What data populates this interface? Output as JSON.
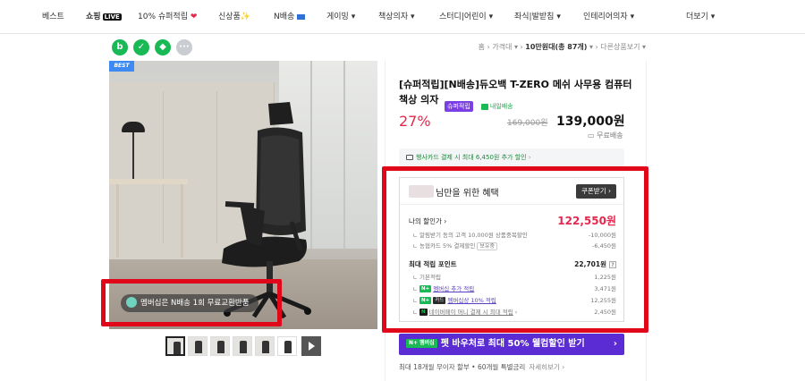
{
  "nav": {
    "items": [
      "베스트",
      "쇼핑",
      "10% 슈퍼적립",
      "신상품",
      "N배송",
      "게이밍",
      "책상의자",
      "스터디|어린이",
      "좌식|발받침",
      "인테리어의자",
      "더보기"
    ],
    "live_badge": "LIVE",
    "super_emoji": "❤",
    "new_emoji": "✨"
  },
  "breadcrumb": [
    "홈",
    "가격대",
    "10만원대(총 87개)",
    "다른상품보기"
  ],
  "image": {
    "best_badge": "BEST",
    "membership_pill": "멤버십은 N배송 1회 무료교환반품"
  },
  "product": {
    "title": "[슈퍼적립][N배송]듀오백 T-ZERO 메쉬 사무용 컴퓨터 책상 의자",
    "badge_super": "슈퍼적립",
    "badge_next": "내일배송",
    "discount": "27%",
    "old_price": "169,000원",
    "price": "139,000원",
    "delivery": "무료배송"
  },
  "card_promo": "행사카드 결제 시 최대 6,450원 추가 할인",
  "benefit": {
    "title": "님만을 위한 혜택",
    "coupon_btn": "쿠폰받기",
    "my_price_label": "나의 할인가",
    "my_price": "122,550원",
    "sub1_label": "알림받기 동의 고객 10,000원 상품중복할인",
    "sub1_val": "-10,000원",
    "sub2_label": "농협카드 5% 결제할인",
    "sub2_pill": "보유중",
    "sub2_val": "-6,450원",
    "points_label": "최대 적립 포인트",
    "points_val": "22,701원",
    "p1_label": "기본적립",
    "p1_val": "1,225원",
    "p2_label": "멤버십 추가 적립",
    "p2_val": "3,471원",
    "p3_label": "멤버십상 10% 적립",
    "p3_val": "12,255원",
    "p4_label": "네이버페이 머니 결제 시 최대 적립",
    "p4_val": "2,450원"
  },
  "promo": {
    "tag": "N+ 멤버십",
    "text": "펫 바우처로 최대 50% 웰컴할인 받기"
  },
  "installment": {
    "text": "최대 18개월 무이자 할부 • 60개월 특별금리",
    "more": "자세히보기"
  },
  "colors": {
    "accent": "#e5284d",
    "naver_green": "#19b955",
    "purple": "#5b2bd3",
    "highlight": "#e0071b"
  }
}
